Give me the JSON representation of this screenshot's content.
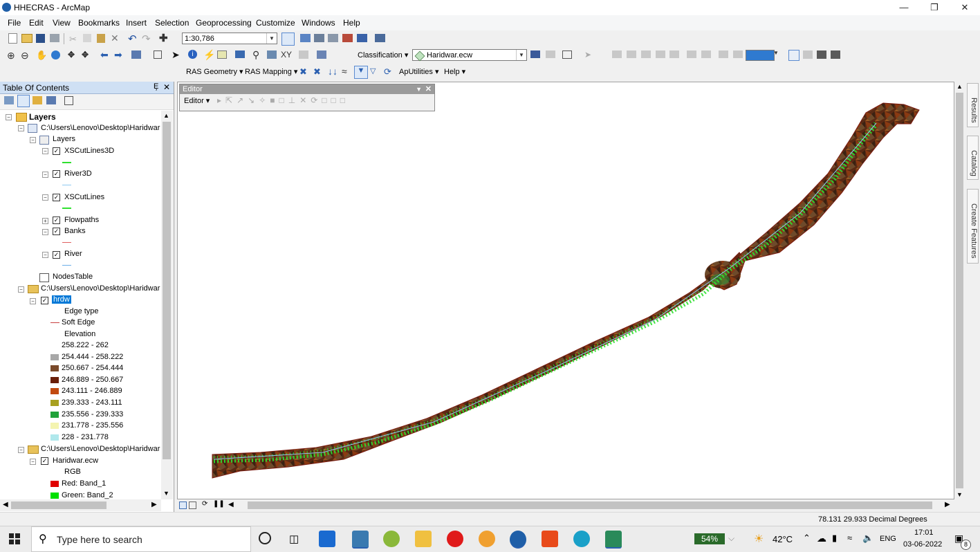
{
  "window": {
    "title": "HHECRAS - ArcMap"
  },
  "menu": [
    "File",
    "Edit",
    "View",
    "Bookmarks",
    "Insert",
    "Selection",
    "Geoprocessing",
    "Customize",
    "Windows",
    "Help"
  ],
  "toolbar": {
    "scale": "1:30,786",
    "classification_label": "Classification",
    "layer_combo": "Haridwar.ecw",
    "ras_geometry": "RAS Geometry",
    "ras_mapping": "RAS Mapping",
    "aputilities": "ApUtilities",
    "help": "Help"
  },
  "editor": {
    "title": "Editor",
    "menu_label": "Editor"
  },
  "toc": {
    "title": "Table Of Contents",
    "pin": "Ȩ",
    "close": "✕",
    "items": [
      {
        "label": "Layers",
        "bold": true
      },
      {
        "label": "C:\\Users\\Lenovo\\Desktop\\Haridwar"
      },
      {
        "label": "Layers"
      },
      {
        "label": "XSCutLines3D",
        "color": "#2fe02f"
      },
      {
        "label": "River3D",
        "color": "#8fc8f0"
      },
      {
        "label": "XSCutLines",
        "color": "#2fe02f"
      },
      {
        "label": "Flowpaths"
      },
      {
        "label": "Banks",
        "color": "#e06060"
      },
      {
        "label": "River",
        "color": "#6aaee8"
      },
      {
        "label": "NodesTable"
      },
      {
        "label": "C:\\Users\\Lenovo\\Desktop\\Haridwar"
      },
      {
        "label": "hrdw"
      },
      {
        "label": "Edge type"
      },
      {
        "label": "Soft Edge",
        "color": "#c84040"
      },
      {
        "label": "Elevation"
      },
      {
        "label": "258.222 - 262",
        "color": "#ffffff"
      },
      {
        "label": "254.444 - 258.222",
        "color": "#a8a8a8"
      },
      {
        "label": "250.667 - 254.444",
        "color": "#7a4a2a"
      },
      {
        "label": "246.889 - 250.667",
        "color": "#6a1e08"
      },
      {
        "label": "243.111 - 246.889",
        "color": "#c24a10"
      },
      {
        "label": "239.333 - 243.111",
        "color": "#a8a020"
      },
      {
        "label": "235.556 - 239.333",
        "color": "#21a23a"
      },
      {
        "label": "231.778 - 235.556",
        "color": "#f4f4b0"
      },
      {
        "label": "228 - 231.778",
        "color": "#b0e8ec"
      },
      {
        "label": "C:\\Users\\Lenovo\\Desktop\\Haridwar"
      },
      {
        "label": "Haridwar.ecw"
      },
      {
        "label": "RGB"
      },
      {
        "label": "Red:    Band_1",
        "color": "#e00000"
      },
      {
        "label": "Green: Band_2",
        "color": "#00e000"
      }
    ]
  },
  "dock": {
    "results": "Results",
    "catalog": "Catalog",
    "create_features": "Create Features"
  },
  "status": {
    "coords": "78.131  29.933 Decimal Degrees"
  },
  "taskbar": {
    "search_placeholder": "Type here to search",
    "battery": "54%",
    "temperature": "42°C",
    "language": "ENG",
    "time": "17:01",
    "date": "03-06-2022",
    "notifications": "8"
  },
  "colors": {
    "xs_lines": "#2fe02f",
    "terrain_dark": "#4a2a18",
    "terrain_red": "#8a2a10",
    "selection": "#0078d7"
  }
}
